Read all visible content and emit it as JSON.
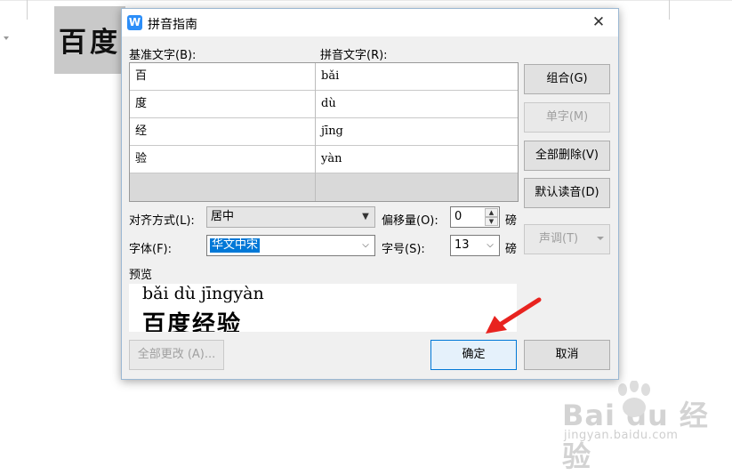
{
  "background": {
    "document_text": "百度",
    "watermark_main": "Bai du 经验",
    "watermark_sub": "jingyan.baidu.com"
  },
  "dialog": {
    "title": "拼音指南",
    "app_icon_glyph": "W",
    "close_glyph": "✕"
  },
  "grid": {
    "col1_header": "基准文字(B):",
    "col2_header": "拼音文字(R):",
    "rows": [
      {
        "base": "百",
        "pinyin": "bǎi"
      },
      {
        "base": "度",
        "pinyin": "dù"
      },
      {
        "base": "经",
        "pinyin": "jīng"
      },
      {
        "base": "验",
        "pinyin": "yàn"
      }
    ]
  },
  "buttons": {
    "combine": "组合(G)",
    "single": "单字(M)",
    "delete_all": "全部删除(V)",
    "default_reading": "默认读音(D)",
    "tone": "声调(T)",
    "change_all": "全部更改 (A)...",
    "ok": "确定",
    "cancel": "取消"
  },
  "settings": {
    "alignment_label": "对齐方式(L):",
    "alignment_value": "居中",
    "offset_label": "偏移量(O):",
    "offset_value": "0",
    "offset_unit": "磅",
    "font_label": "字体(F):",
    "font_value": "华文中宋",
    "size_label": "字号(S):",
    "size_value": "13",
    "size_unit": "磅"
  },
  "preview": {
    "label": "预览",
    "pinyin_line": "bǎi  dù  jīngyàn",
    "hanzi_line": "百度经验"
  },
  "colors": {
    "accent": "#0078d7",
    "annotation_arrow": "#e8231f"
  }
}
